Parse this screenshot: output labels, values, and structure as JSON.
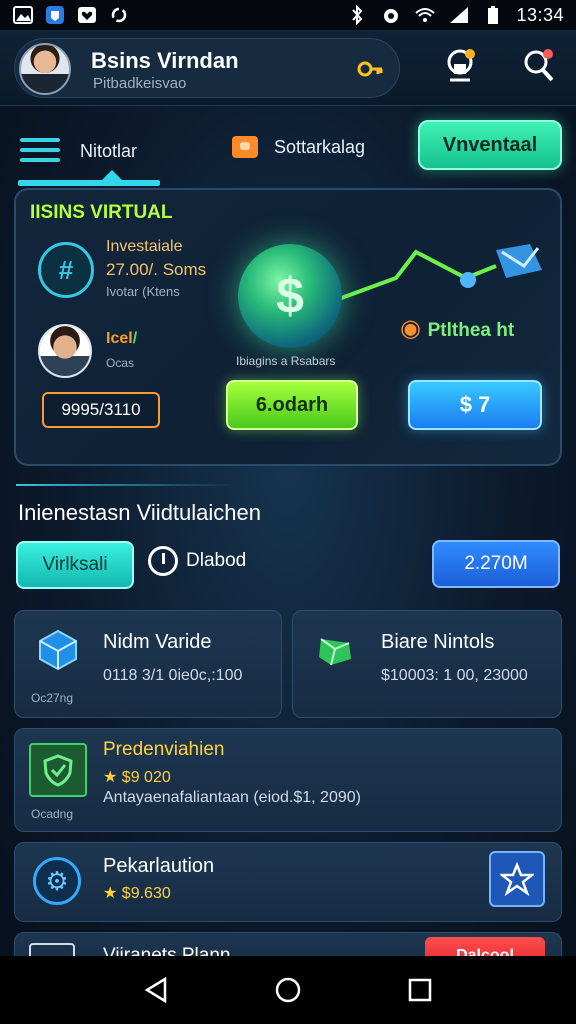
{
  "status_bar": {
    "time": "13:34",
    "left_icons": [
      "image-icon",
      "shield-app-icon",
      "heart-icon",
      "sync-icon"
    ],
    "right_icons": [
      "bluetooth-icon",
      "alarm-icon",
      "wifi-icon",
      "signal-icon",
      "battery-icon"
    ]
  },
  "header": {
    "user_name": "Bsins Virndan",
    "user_subtitle": "Pitbadkeisvao"
  },
  "tabs": {
    "menu_label": "Nitotlar",
    "category_label": "Sottarkalag",
    "inventory_button": "Vnventaal"
  },
  "hero": {
    "title": "IISINS VIRTUAL",
    "investment_title": "Investaiale",
    "investment_value": "27.00/. Soms",
    "investment_sub": "Ivotar (Ktens",
    "person_badge_a": "Icel",
    "person_badge_b": "/",
    "person_sub": "Ocas",
    "amount_pill": "9995/3110",
    "globe_caption": "Ibiagins a Rsabars",
    "profit_label": "Ptlthea ht",
    "green_button": "6.odarh",
    "blue_button": "$ 7"
  },
  "section": {
    "title": "Inienestasn Viidtulaichen",
    "filter_button": "Virlksali",
    "period_label": "Dlabod",
    "value_button": "2.270M"
  },
  "cards": [
    {
      "title": "Nidm Varide",
      "subtitle": "0118 3/1 0ie0c,:100",
      "footer": "Oc27ng"
    },
    {
      "title": "Biare Nintols",
      "subtitle": "$10003: 1 00, 23000"
    },
    {
      "title": "Predenviahien",
      "price": "$9 020",
      "subtitle": "Antayaenafaliantaan (eiod.$1, 2090)",
      "footer": "Ocadng"
    },
    {
      "title": "Pekarlaution",
      "price": "$9.630"
    },
    {
      "title": "Viiranets Plann",
      "button": "Dalcool"
    }
  ],
  "colors": {
    "accent_cyan": "#33d7ec",
    "accent_green": "#b6ff3d",
    "accent_gold": "#ffd23a",
    "accent_orange": "#ff9933",
    "accent_blue": "#2f8cff"
  }
}
